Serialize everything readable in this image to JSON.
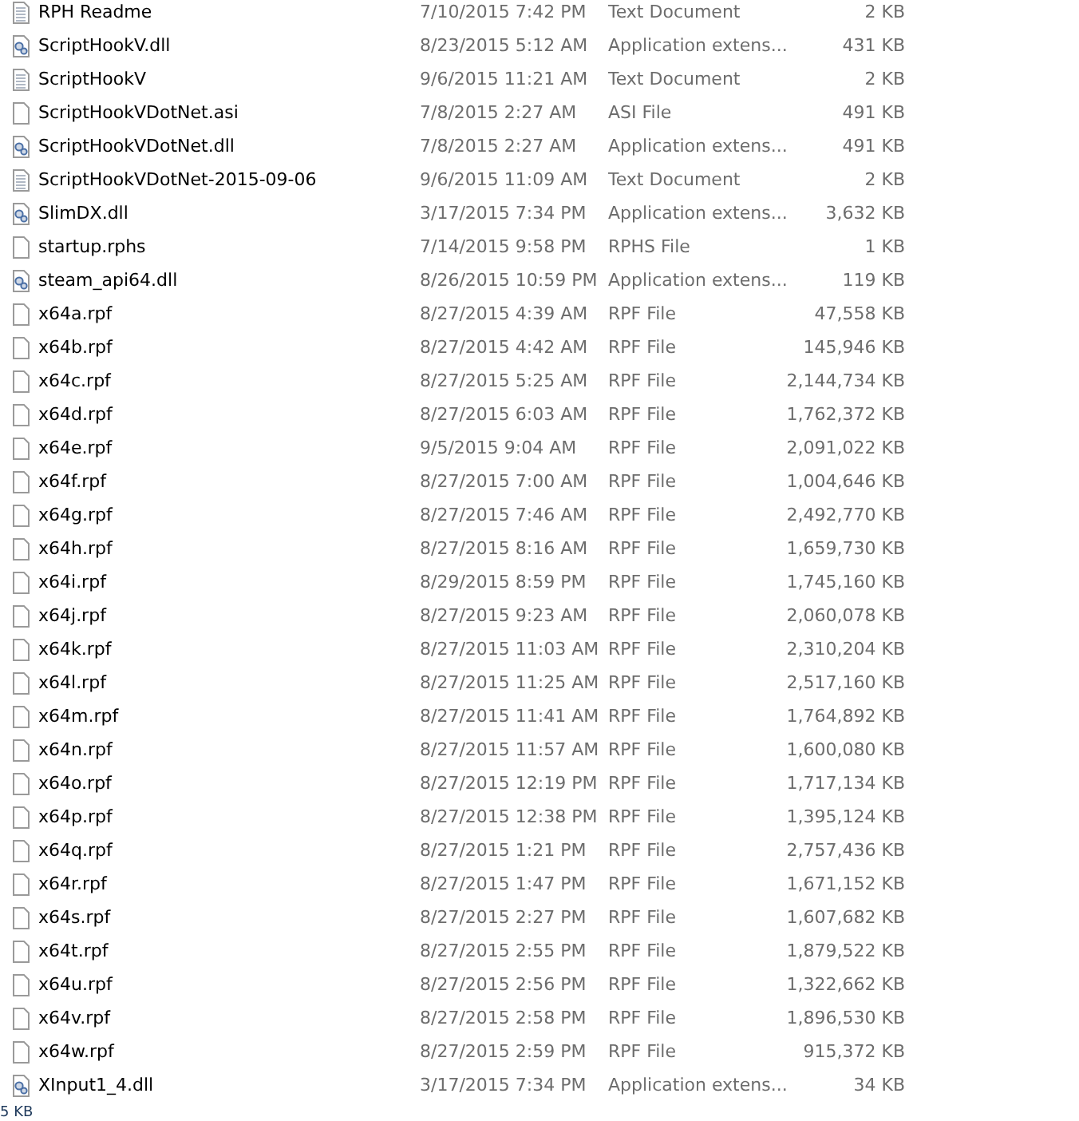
{
  "files": [
    {
      "kind": "text",
      "name": "RPH Readme",
      "date": "7/10/2015 7:42 PM",
      "type": "Text Document",
      "size": "2 KB"
    },
    {
      "kind": "dll",
      "name": "ScriptHookV.dll",
      "date": "8/23/2015 5:12 AM",
      "type": "Application extens...",
      "size": "431 KB"
    },
    {
      "kind": "text",
      "name": "ScriptHookV",
      "date": "9/6/2015 11:21 AM",
      "type": "Text Document",
      "size": "2 KB"
    },
    {
      "kind": "blank",
      "name": "ScriptHookVDotNet.asi",
      "date": "7/8/2015 2:27 AM",
      "type": "ASI File",
      "size": "491 KB"
    },
    {
      "kind": "dll",
      "name": "ScriptHookVDotNet.dll",
      "date": "7/8/2015 2:27 AM",
      "type": "Application extens...",
      "size": "491 KB"
    },
    {
      "kind": "text",
      "name": "ScriptHookVDotNet-2015-09-06",
      "date": "9/6/2015 11:09 AM",
      "type": "Text Document",
      "size": "2 KB"
    },
    {
      "kind": "dll",
      "name": "SlimDX.dll",
      "date": "3/17/2015 7:34 PM",
      "type": "Application extens...",
      "size": "3,632 KB"
    },
    {
      "kind": "blank",
      "name": "startup.rphs",
      "date": "7/14/2015 9:58 PM",
      "type": "RPHS File",
      "size": "1 KB"
    },
    {
      "kind": "dll",
      "name": "steam_api64.dll",
      "date": "8/26/2015 10:59 PM",
      "type": "Application extens...",
      "size": "119 KB"
    },
    {
      "kind": "blank",
      "name": "x64a.rpf",
      "date": "8/27/2015 4:39 AM",
      "type": "RPF File",
      "size": "47,558 KB"
    },
    {
      "kind": "blank",
      "name": "x64b.rpf",
      "date": "8/27/2015 4:42 AM",
      "type": "RPF File",
      "size": "145,946 KB"
    },
    {
      "kind": "blank",
      "name": "x64c.rpf",
      "date": "8/27/2015 5:25 AM",
      "type": "RPF File",
      "size": "2,144,734 KB"
    },
    {
      "kind": "blank",
      "name": "x64d.rpf",
      "date": "8/27/2015 6:03 AM",
      "type": "RPF File",
      "size": "1,762,372 KB"
    },
    {
      "kind": "blank",
      "name": "x64e.rpf",
      "date": "9/5/2015 9:04 AM",
      "type": "RPF File",
      "size": "2,091,022 KB"
    },
    {
      "kind": "blank",
      "name": "x64f.rpf",
      "date": "8/27/2015 7:00 AM",
      "type": "RPF File",
      "size": "1,004,646 KB"
    },
    {
      "kind": "blank",
      "name": "x64g.rpf",
      "date": "8/27/2015 7:46 AM",
      "type": "RPF File",
      "size": "2,492,770 KB"
    },
    {
      "kind": "blank",
      "name": "x64h.rpf",
      "date": "8/27/2015 8:16 AM",
      "type": "RPF File",
      "size": "1,659,730 KB"
    },
    {
      "kind": "blank",
      "name": "x64i.rpf",
      "date": "8/29/2015 8:59 PM",
      "type": "RPF File",
      "size": "1,745,160 KB"
    },
    {
      "kind": "blank",
      "name": "x64j.rpf",
      "date": "8/27/2015 9:23 AM",
      "type": "RPF File",
      "size": "2,060,078 KB"
    },
    {
      "kind": "blank",
      "name": "x64k.rpf",
      "date": "8/27/2015 11:03 AM",
      "type": "RPF File",
      "size": "2,310,204 KB"
    },
    {
      "kind": "blank",
      "name": "x64l.rpf",
      "date": "8/27/2015 11:25 AM",
      "type": "RPF File",
      "size": "2,517,160 KB"
    },
    {
      "kind": "blank",
      "name": "x64m.rpf",
      "date": "8/27/2015 11:41 AM",
      "type": "RPF File",
      "size": "1,764,892 KB"
    },
    {
      "kind": "blank",
      "name": "x64n.rpf",
      "date": "8/27/2015 11:57 AM",
      "type": "RPF File",
      "size": "1,600,080 KB"
    },
    {
      "kind": "blank",
      "name": "x64o.rpf",
      "date": "8/27/2015 12:19 PM",
      "type": "RPF File",
      "size": "1,717,134 KB"
    },
    {
      "kind": "blank",
      "name": "x64p.rpf",
      "date": "8/27/2015 12:38 PM",
      "type": "RPF File",
      "size": "1,395,124 KB"
    },
    {
      "kind": "blank",
      "name": "x64q.rpf",
      "date": "8/27/2015 1:21 PM",
      "type": "RPF File",
      "size": "2,757,436 KB"
    },
    {
      "kind": "blank",
      "name": "x64r.rpf",
      "date": "8/27/2015 1:47 PM",
      "type": "RPF File",
      "size": "1,671,152 KB"
    },
    {
      "kind": "blank",
      "name": "x64s.rpf",
      "date": "8/27/2015 2:27 PM",
      "type": "RPF File",
      "size": "1,607,682 KB"
    },
    {
      "kind": "blank",
      "name": "x64t.rpf",
      "date": "8/27/2015 2:55 PM",
      "type": "RPF File",
      "size": "1,879,522 KB"
    },
    {
      "kind": "blank",
      "name": "x64u.rpf",
      "date": "8/27/2015 2:56 PM",
      "type": "RPF File",
      "size": "1,322,662 KB"
    },
    {
      "kind": "blank",
      "name": "x64v.rpf",
      "date": "8/27/2015 2:58 PM",
      "type": "RPF File",
      "size": "1,896,530 KB"
    },
    {
      "kind": "blank",
      "name": "x64w.rpf",
      "date": "8/27/2015 2:59 PM",
      "type": "RPF File",
      "size": "915,372 KB"
    },
    {
      "kind": "dll",
      "name": "XInput1_4.dll",
      "date": "3/17/2015 7:34 PM",
      "type": "Application extens...",
      "size": "34 KB"
    }
  ],
  "status_bar": {
    "size": "5 KB"
  }
}
